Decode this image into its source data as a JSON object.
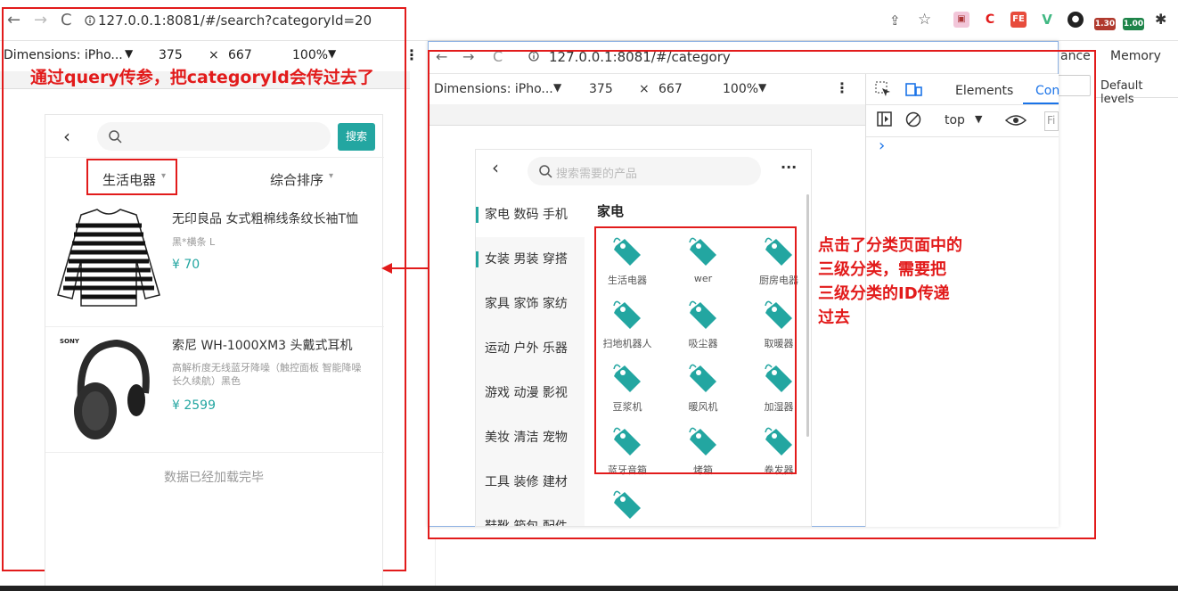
{
  "browser": {
    "url": "127.0.0.1:8081/#/search?categoryId=20",
    "ext_badge1": "1.30",
    "ext_badge2": "1.00"
  },
  "devbar_left": {
    "device": "Dimensions: iPho...",
    "width": "375",
    "x": "×",
    "height": "667",
    "zoom": "100%"
  },
  "annotation_left": "通过query传参，把categoryId会传过去了",
  "search_page": {
    "search_button": "搜索",
    "filter1": "生活电器",
    "filter2": "综合排序",
    "products": [
      {
        "title": "无印良品 女式粗棉线条纹长袖T恤",
        "desc": "黑*横条 L",
        "price": "¥ 70"
      },
      {
        "title": "索尼 WH-1000XM3 头戴式耳机",
        "desc": "高解析度无线蓝牙降噪（触控面板 智能降噪 长久续航）黑色",
        "price": "¥ 2599",
        "brand": "SONY"
      }
    ],
    "footer": "数据已经加载完毕"
  },
  "inner_browser": {
    "url": "127.0.0.1:8081/#/category",
    "device": "Dimensions: iPho...",
    "width": "375",
    "x": "×",
    "height": "667",
    "zoom": "100%"
  },
  "category_page": {
    "search_placeholder": "搜索需要的产品",
    "more": "···",
    "menu": [
      "家电 数码 手机",
      "女装 男装 穿搭",
      "家具 家饰 家纺",
      "运动 户外 乐器",
      "游戏 动漫 影视",
      "美妆 清洁 宠物",
      "工具 装修 建材",
      "鞋靴 箱包 配件"
    ],
    "section_title": "家电",
    "items": [
      "生活电器",
      "wer",
      "厨房电器",
      "扫地机器人",
      "吸尘器",
      "取暖器",
      "豆浆机",
      "暖风机",
      "加湿器",
      "蓝牙音箱",
      "烤箱",
      "卷发器"
    ]
  },
  "annotation_right": [
    "点击了分类页面中的",
    "三级分类，需要把",
    "三级分类的ID传递",
    "过去"
  ],
  "devtools": {
    "tabs": [
      "Elements",
      "Con"
    ],
    "partial_tab": "ance",
    "memory": "Memory",
    "levels": "Default levels",
    "context": "top",
    "filter": "Fi",
    "prompt": "›"
  },
  "colors": {
    "accent": "#23a6a1",
    "annotation": "#e21b1b",
    "price": "#23a6a1"
  }
}
